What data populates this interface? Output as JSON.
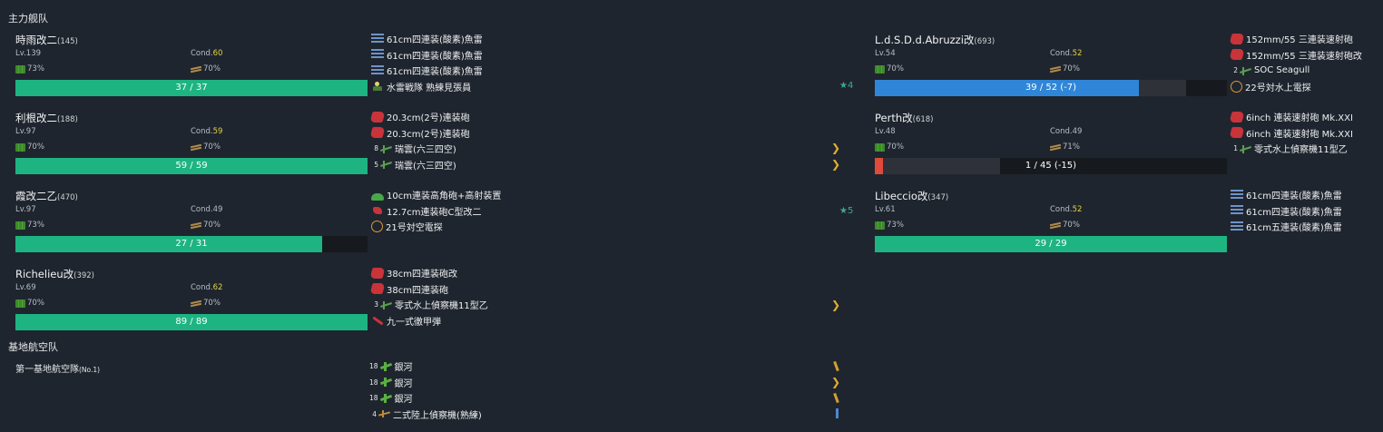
{
  "sections": {
    "main_fleet": "主力舰队",
    "base_air": "基地航空队"
  },
  "ships_left": [
    {
      "name": "時雨改二",
      "id": "(145)",
      "lv": "Lv.139",
      "cond_label": "Cond.",
      "cond": "60",
      "fuel": "73%",
      "ammo": "70%",
      "hp": "37 / 37",
      "hp_frac": 1.0,
      "hp_color": "#1db481"
    },
    {
      "name": "利根改二",
      "id": "(188)",
      "lv": "Lv.97",
      "cond_label": "Cond.",
      "cond": "59",
      "fuel": "70%",
      "ammo": "70%",
      "hp": "59 / 59",
      "hp_frac": 1.0,
      "hp_color": "#1db481"
    },
    {
      "name": "霞改二乙",
      "id": "(470)",
      "lv": "Lv.97",
      "cond_label": "Cond.",
      "cond": "49",
      "fuel": "73%",
      "ammo": "70%",
      "hp": "27 / 31",
      "hp_frac": 0.871,
      "hp_color": "#1db481"
    },
    {
      "name": "Richelieu改",
      "id": "(392)",
      "lv": "Lv.69",
      "cond_label": "Cond.",
      "cond": "62",
      "fuel": "70%",
      "ammo": "70%",
      "hp": "89 / 89",
      "hp_frac": 1.0,
      "hp_color": "#1db481"
    }
  ],
  "ships_right": [
    {
      "name": "L.d.S.D.d.Abruzzi改",
      "id": "(693)",
      "lv": "Lv.54",
      "cond_label": "Cond.",
      "cond": "52",
      "fuel": "70%",
      "ammo": "70%",
      "hp": "39 / 52 (-7)",
      "hp_frac": 0.75,
      "hp_color": "#2f86d8",
      "hp_prev_frac": 0.885
    },
    {
      "name": "Perth改",
      "id": "(618)",
      "lv": "Lv.48",
      "cond_label": "Cond.",
      "cond": "49",
      "fuel": "70%",
      "ammo": "71%",
      "hp": "1 / 45 (-15)",
      "hp_frac": 0.022,
      "hp_color": "#e04a3a",
      "hp_prev_frac": 0.356
    },
    {
      "name": "Libeccio改",
      "id": "(347)",
      "lv": "Lv.61",
      "cond_label": "Cond.",
      "cond": "52",
      "fuel": "73%",
      "ammo": "70%",
      "hp": "29 / 29",
      "hp_frac": 1.0,
      "hp_color": "#1db481"
    }
  ],
  "equip_left": [
    [
      {
        "icon": "torpedo-icon",
        "name": "61cm四連装(酸素)魚雷"
      },
      {
        "icon": "torpedo-icon",
        "name": "61cm四連装(酸素)魚雷"
      },
      {
        "icon": "torpedo-icon",
        "name": "61cm四連装(酸素)魚雷"
      },
      {
        "icon": "crew-icon",
        "name": "水雷戦隊 熟練見張員"
      }
    ],
    [
      {
        "icon": "gun-icon",
        "name": "20.3cm(2号)連装砲"
      },
      {
        "icon": "gun-icon",
        "name": "20.3cm(2号)連装砲"
      },
      {
        "icon": "seaplane-icon",
        "name": "瑞雲(六三四空)",
        "slot": "8"
      },
      {
        "icon": "seaplane-icon",
        "name": "瑞雲(六三四空)",
        "slot": "5"
      }
    ],
    [
      {
        "icon": "aa-gun-icon",
        "name": "10cm連装高角砲+高射装置"
      },
      {
        "icon": "small-gun-icon",
        "name": "12.7cm連装砲C型改二"
      },
      {
        "icon": "radar-icon",
        "name": "21号対空電探"
      }
    ],
    [
      {
        "icon": "gun-icon",
        "name": "38cm四連装砲改"
      },
      {
        "icon": "gun-icon",
        "name": "38cm四連装砲"
      },
      {
        "icon": "seaplane-icon",
        "name": "零式水上偵察機11型乙",
        "slot": "3"
      },
      {
        "icon": "ap-shell-icon",
        "name": "九一式徹甲弾"
      }
    ]
  ],
  "equip_right": [
    [
      {
        "icon": "gun-icon",
        "name": "152mm/55 三連装速射砲"
      },
      {
        "icon": "gun-icon",
        "name": "152mm/55 三連装速射砲改"
      },
      {
        "icon": "seaplane-icon",
        "name": "SOC Seagull",
        "slot": "2"
      },
      {
        "icon": "radar-icon",
        "name": "22号対水上電探"
      }
    ],
    [
      {
        "icon": "gun-icon",
        "name": "6inch 連装速射砲 Mk.XXI"
      },
      {
        "icon": "gun-icon",
        "name": "6inch 連装速射砲 Mk.XXI"
      },
      {
        "icon": "seaplane-icon",
        "name": "零式水上偵察機11型乙",
        "slot": "1"
      }
    ],
    [
      {
        "icon": "torpedo-icon",
        "name": "61cm四連装(酸素)魚雷"
      },
      {
        "icon": "torpedo-icon",
        "name": "61cm四連装(酸素)魚雷"
      },
      {
        "icon": "torpedo-icon",
        "name": "61cm五連装(酸素)魚雷"
      }
    ]
  ],
  "stars": [
    {
      "text": "★4"
    },
    {
      "text": "★5"
    }
  ],
  "base_air": {
    "name": "第一基地航空隊",
    "no": "(No.1)",
    "planes": [
      {
        "slot": "18",
        "name": "銀河",
        "icon": "bomber-icon"
      },
      {
        "slot": "18",
        "name": "銀河",
        "icon": "bomber-icon"
      },
      {
        "slot": "18",
        "name": "銀河",
        "icon": "bomber-icon"
      },
      {
        "slot": "4",
        "name": "二式陸上偵察機(熟練)",
        "icon": "recon-plane-icon"
      }
    ]
  },
  "colors": {
    "hp_green": "#1db481",
    "hp_blue": "#2f86d8",
    "hp_red": "#e04a3a",
    "cond_yellow": "#e0d24a",
    "proficiency": "#e0b030"
  }
}
